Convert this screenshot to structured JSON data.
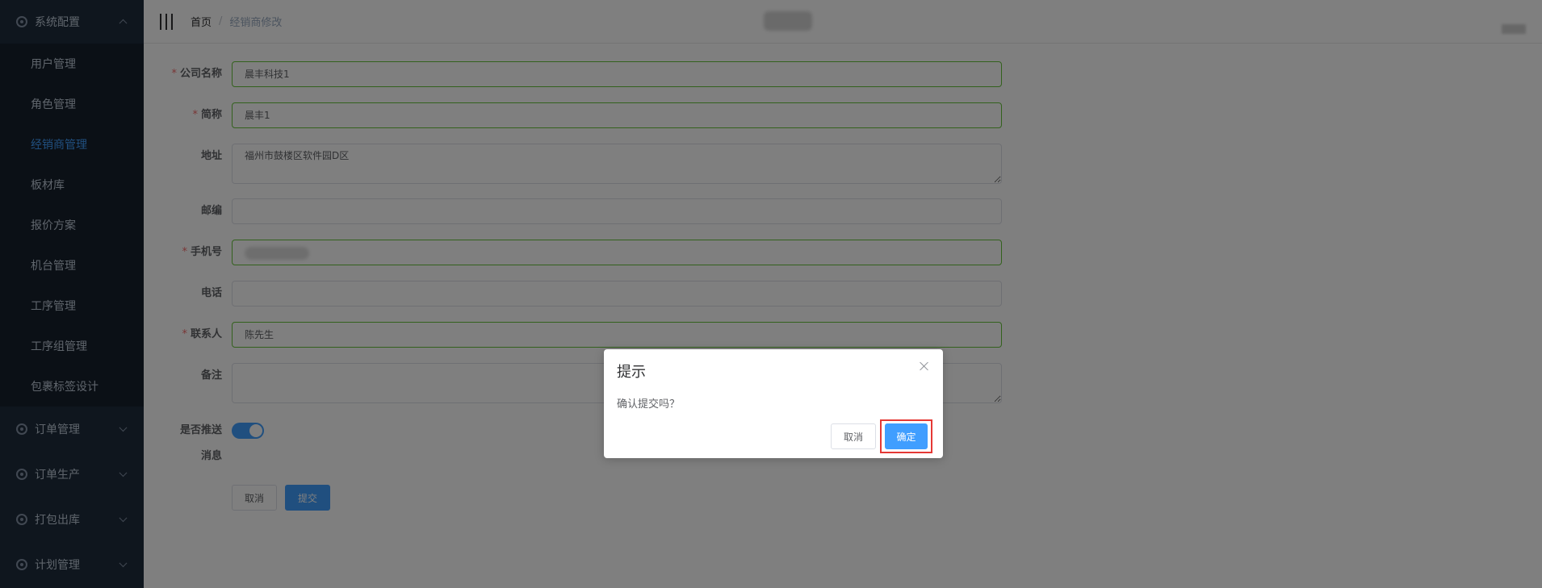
{
  "sidebar": {
    "system_config": {
      "label": "系统配置",
      "items": [
        "用户管理",
        "角色管理",
        "经销商管理",
        "板材库",
        "报价方案",
        "机台管理",
        "工序管理",
        "工序组管理",
        "包裹标签设计"
      ],
      "active": "经销商管理"
    },
    "groups": [
      "订单管理",
      "订单生产",
      "打包出库",
      "计划管理"
    ]
  },
  "navbar": {
    "breadcrumb": {
      "home": "首页",
      "separator": "/",
      "current": "经销商修改"
    }
  },
  "form": {
    "company_name": {
      "label": "公司名称",
      "value": "晨丰科技1"
    },
    "short_name": {
      "label": "简称",
      "value": "晨丰1"
    },
    "address": {
      "label": "地址",
      "value": "福州市鼓楼区软件园D区"
    },
    "postcode": {
      "label": "邮编",
      "value": ""
    },
    "mobile": {
      "label": "手机号",
      "value": ""
    },
    "phone": {
      "label": "电话",
      "value": ""
    },
    "contact": {
      "label": "联系人",
      "value": "陈先生"
    },
    "remark": {
      "label": "备注",
      "value": ""
    },
    "push_message": {
      "label_line1": "是否推送",
      "label_line2": "消息",
      "enabled": true
    },
    "required_mark": "*",
    "cancel_label": "取消",
    "submit_label": "提交"
  },
  "dialog": {
    "title": "提示",
    "message": "确认提交吗？",
    "cancel_label": "取消",
    "confirm_label": "确定"
  },
  "colors": {
    "sidebar_bg": "#1f2d3d",
    "active_menu": "#409eff",
    "primary": "#409eff",
    "valid_border": "#67c23a",
    "required": "#f56c6c",
    "highlight_box": "#e53935"
  }
}
